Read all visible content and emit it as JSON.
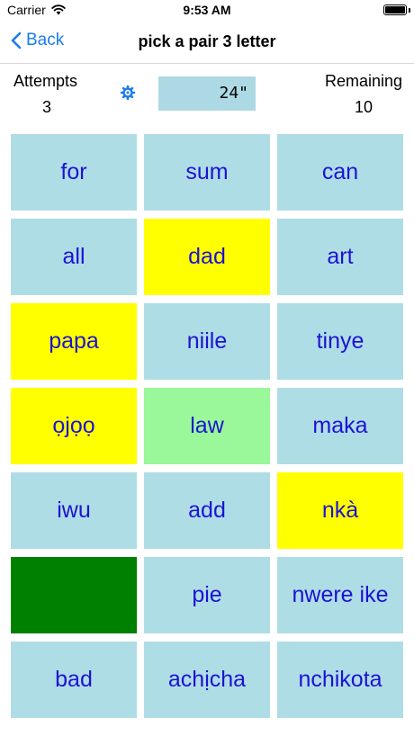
{
  "status": {
    "carrier": "Carrier",
    "time": "9:53 AM"
  },
  "nav": {
    "back_label": "Back",
    "title": "pick a pair 3 letter"
  },
  "stats": {
    "attempts_label": "Attempts",
    "attempts_value": "3",
    "remaining_label": "Remaining",
    "remaining_value": "10",
    "timer": "24\""
  },
  "colors": {
    "cell_default": "#afdde6",
    "cell_selected": "#ffff00",
    "cell_matched": "#9af79a",
    "cell_revealed": "#008000",
    "word_text": "#1c13d2",
    "accent": "#1a7cf0"
  },
  "cells": [
    {
      "word": "for",
      "state": "default"
    },
    {
      "word": "sum",
      "state": "default"
    },
    {
      "word": "can",
      "state": "default"
    },
    {
      "word": "all",
      "state": "default"
    },
    {
      "word": "dad",
      "state": "selected"
    },
    {
      "word": "art",
      "state": "default"
    },
    {
      "word": "papa",
      "state": "selected"
    },
    {
      "word": "niile",
      "state": "default"
    },
    {
      "word": "tinye",
      "state": "default"
    },
    {
      "word": "ọjọọ",
      "state": "selected"
    },
    {
      "word": "law",
      "state": "matched"
    },
    {
      "word": "maka",
      "state": "default"
    },
    {
      "word": "iwu",
      "state": "default"
    },
    {
      "word": "add",
      "state": "default"
    },
    {
      "word": "nkà",
      "state": "selected"
    },
    {
      "word": "",
      "state": "revealed"
    },
    {
      "word": "pie",
      "state": "default"
    },
    {
      "word": "nwere ike",
      "state": "default"
    },
    {
      "word": "bad",
      "state": "default"
    },
    {
      "word": "achịcha",
      "state": "default"
    },
    {
      "word": "nchikota",
      "state": "default"
    }
  ]
}
